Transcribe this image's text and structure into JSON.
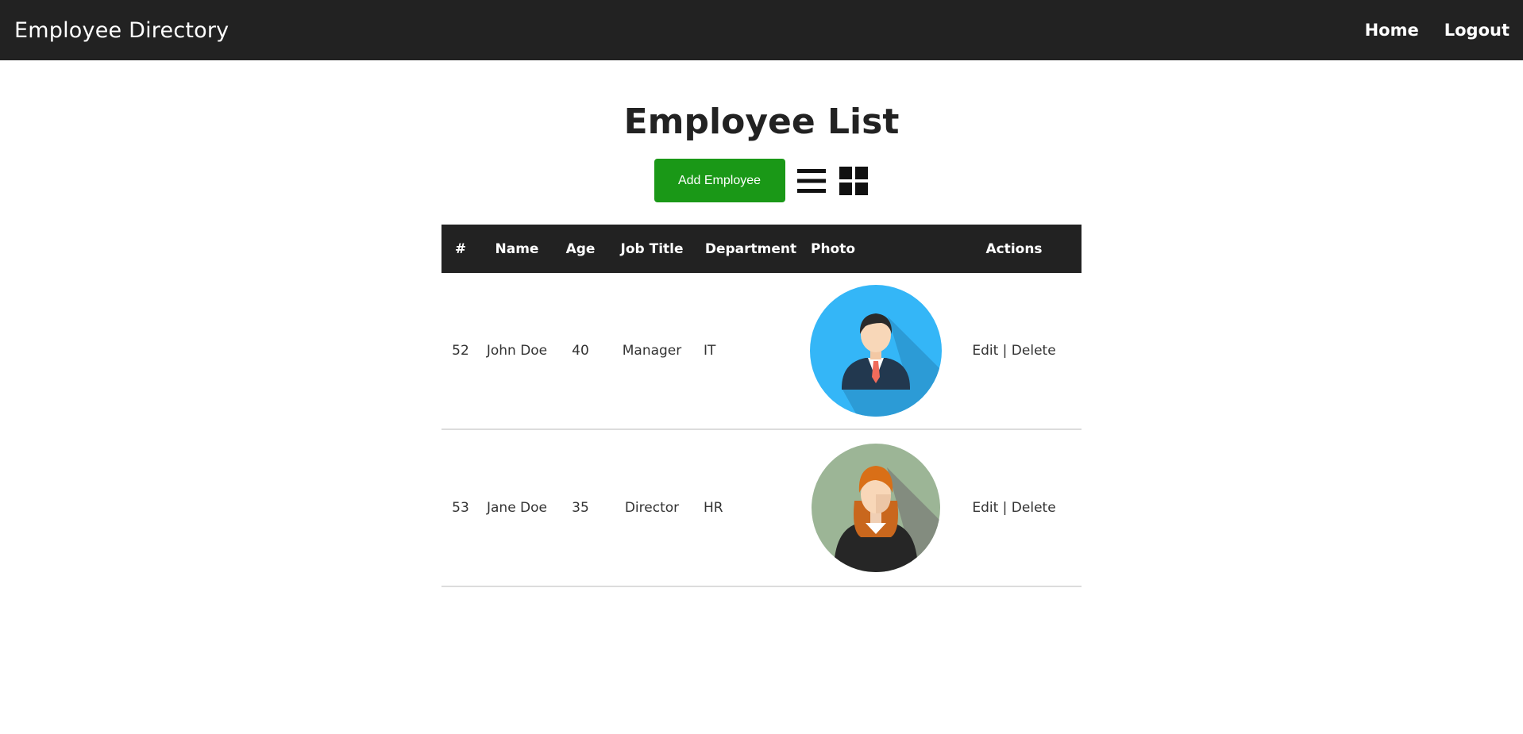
{
  "navbar": {
    "brand": "Employee Directory",
    "links": [
      {
        "label": "Home"
      },
      {
        "label": "Logout"
      }
    ]
  },
  "page": {
    "title": "Employee List",
    "add_button_label": "Add Employee",
    "list_view_icon": "list-icon",
    "grid_view_icon": "grid-icon"
  },
  "colors": {
    "navbar": "#222222",
    "add_button": "#1a9817",
    "male_avatar_bg": "#34b6f7",
    "female_avatar_bg": "#9cb596"
  },
  "table": {
    "headers": [
      "#",
      "Name",
      "Age",
      "Job Title",
      "Department",
      "Photo",
      "Actions"
    ],
    "rows": [
      {
        "id": "52",
        "name": "John Doe",
        "age": "40",
        "job_title": "Manager",
        "department": "IT",
        "photo": "male-avatar",
        "edit": "Edit",
        "sep": "|",
        "delete": "Delete"
      },
      {
        "id": "53",
        "name": "Jane Doe",
        "age": "35",
        "job_title": "Director",
        "department": "HR",
        "photo": "female-avatar",
        "edit": "Edit",
        "sep": "|",
        "delete": "Delete"
      }
    ]
  }
}
